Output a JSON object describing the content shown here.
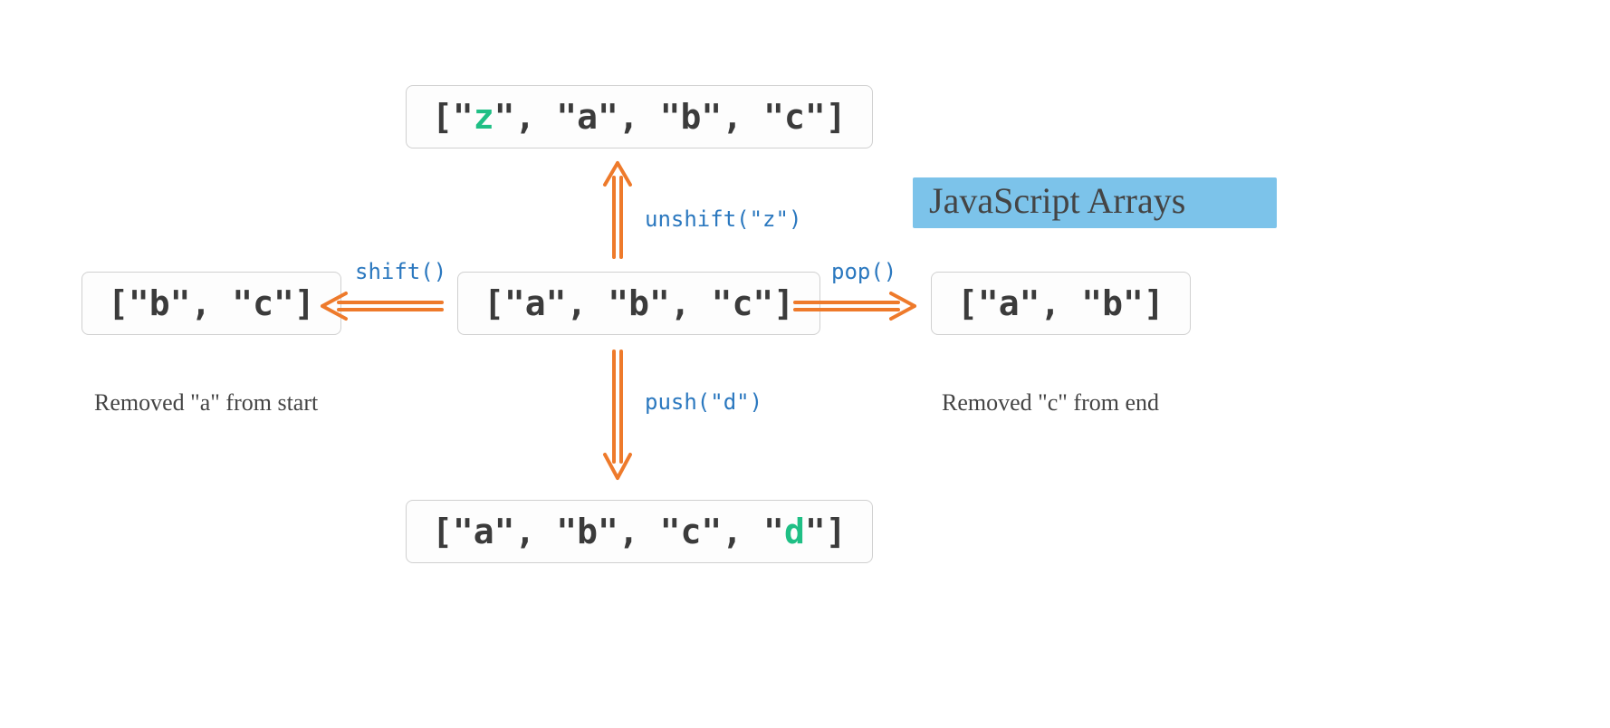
{
  "title": "JavaScript Arrays",
  "center": {
    "elements": [
      "a",
      "b",
      "c"
    ]
  },
  "top": {
    "method": "unshift(\"z\")",
    "elements": [
      "z",
      "a",
      "b",
      "c"
    ],
    "highlightIndex": 0
  },
  "bottom": {
    "method": "push(\"d\")",
    "elements": [
      "a",
      "b",
      "c",
      "d"
    ],
    "highlightIndex": 3
  },
  "left": {
    "method": "shift()",
    "elements": [
      "b",
      "c"
    ],
    "note": "Removed \"a\" from start"
  },
  "right": {
    "method": "pop()",
    "elements": [
      "a",
      "b"
    ],
    "note": "Removed \"c\" from end"
  }
}
